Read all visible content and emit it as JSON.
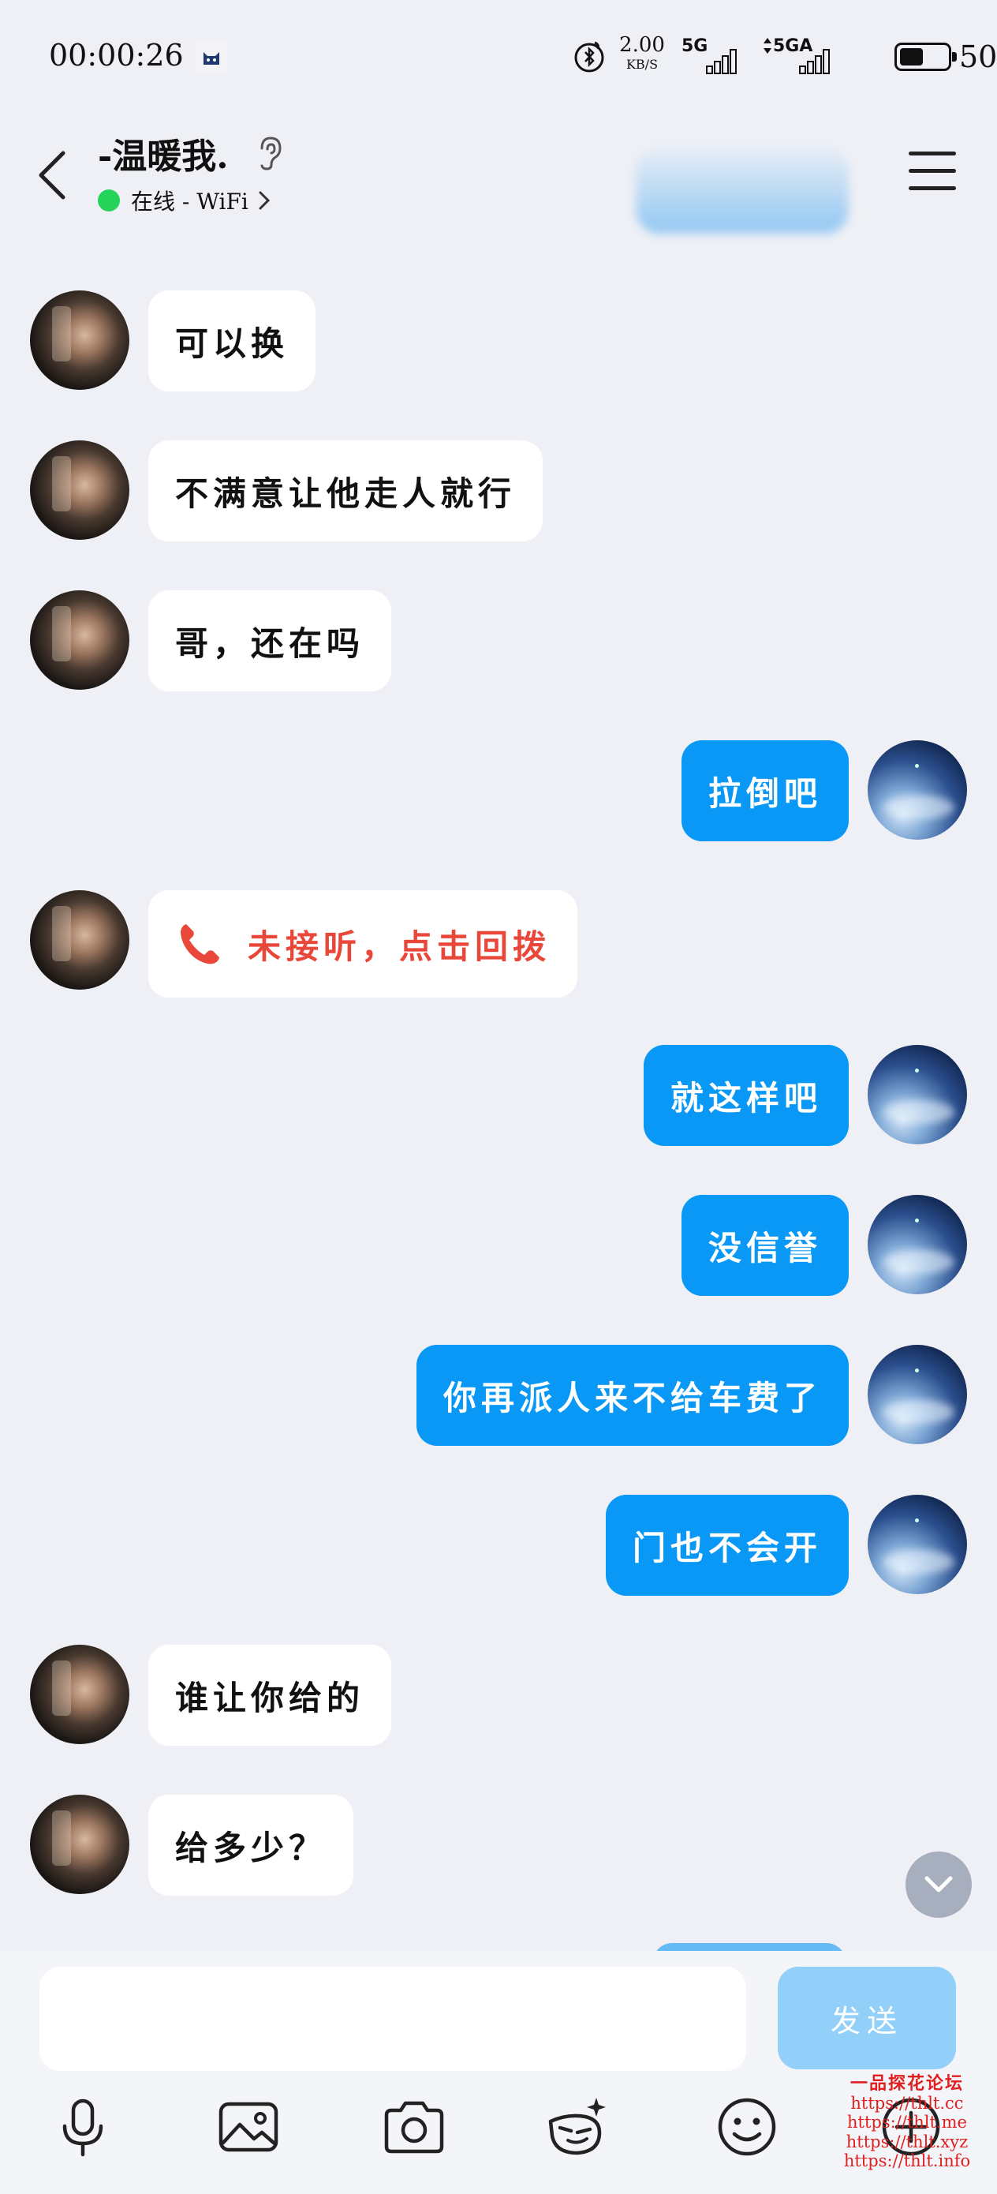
{
  "status_bar": {
    "time": "00:00:26",
    "net_speed_value": "2.00",
    "net_speed_unit": "KB/S",
    "signal1_label": "5G",
    "signal2_label": "5GA",
    "battery_percent": "50%",
    "battery_level": 0.5
  },
  "header": {
    "contact_name": "-温暖我.",
    "status_text": "在线 - WiFi",
    "status_color": "#25d35a"
  },
  "messages": [
    {
      "side": "peer",
      "text": "可以换"
    },
    {
      "side": "peer",
      "text": "不满意让他走人就行"
    },
    {
      "side": "peer",
      "text": "哥，还在吗"
    },
    {
      "side": "me",
      "text": "拉倒吧"
    },
    {
      "side": "peer",
      "text": "未接听，点击回拨",
      "type": "missed-call"
    },
    {
      "side": "me",
      "text": "就这样吧"
    },
    {
      "side": "me",
      "text": "没信誉"
    },
    {
      "side": "me",
      "text": "你再派人来不给车费了"
    },
    {
      "side": "me",
      "text": "门也不会开"
    },
    {
      "side": "peer",
      "text": "谁让你给的"
    },
    {
      "side": "peer",
      "text": "给多少？"
    }
  ],
  "input": {
    "value": "",
    "send_label": "发送"
  },
  "toolbar": [
    "microphone-icon",
    "image-icon",
    "camera-icon",
    "sticker-icon",
    "emoji-icon",
    "plus-icon"
  ],
  "colors": {
    "background": "#eff0f5",
    "my_bubble": "#0998f5",
    "peer_bubble": "#ffffff",
    "missed_call": "#e8473a",
    "send_button_disabled": "#92d0fa"
  },
  "watermark": {
    "title": "一品探花论坛",
    "links": [
      "https://thlt.cc",
      "https://thlt.me",
      "https://thlt.xyz",
      "https://thlt.info"
    ]
  }
}
